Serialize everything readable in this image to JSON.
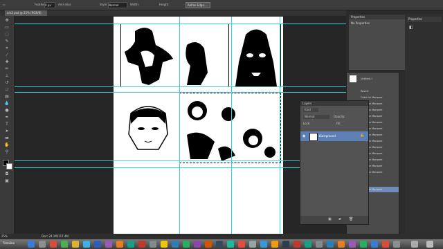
{
  "options_bar": {
    "feather_label": "Feather:",
    "feather_value": "0 px",
    "antialias_label": "Anti-alias",
    "style_label": "Style:",
    "style_value": "Normal",
    "width_label": "Width:",
    "height_label": "Height:",
    "refine_edge": "Refine Edge..."
  },
  "document": {
    "tab_title": "ark3.psd @ 25% (RGB/8)"
  },
  "status_bar": {
    "zoom": "25%",
    "doc_size": "Doc: 24.1M/117.4M",
    "timeline_label": "Timeline"
  },
  "properties_panel": {
    "title": "Properties",
    "content": "No Properties"
  },
  "right_column": {
    "properties_tab": "Properties"
  },
  "history_panel": {
    "snapshot": "Untitled-1",
    "items": [
      "Revert",
      "Color for Marquee",
      "Color for Marquee",
      "Color for Marquee",
      "Color for Marquee",
      "Color for Marquee",
      "Color for Marquee",
      "Color for Marquee",
      "Color for Marquee",
      "Color for Marquee",
      "Color for Marquee",
      "Color for Marquee",
      "Color for Marquee",
      "Color for Marquee",
      "Color for Marquee"
    ]
  },
  "layers_panel": {
    "title": "Layers",
    "filter_kind": "Kind",
    "blend_mode": "Normal",
    "opacity_label": "Opacity:",
    "lock_label": "Lock:",
    "fill_label": "Fill:",
    "layer_name": "Background"
  },
  "colors": {
    "guide": "#3ad0e0",
    "layer_selected": "#5c80b4",
    "history_selected": "#6e8cb8"
  }
}
